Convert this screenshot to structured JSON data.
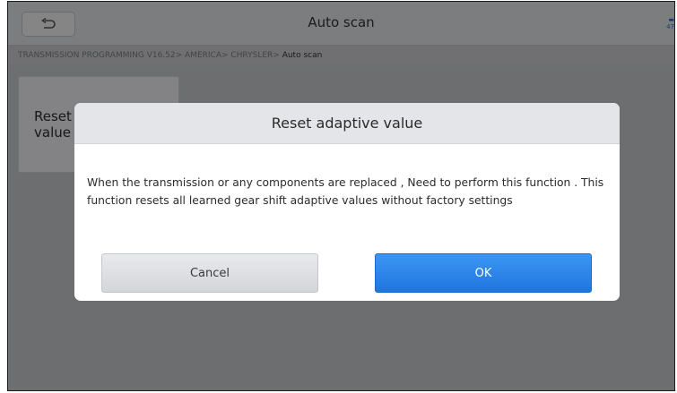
{
  "header": {
    "title": "Auto scan",
    "back_icon": "undo-arrow-icon"
  },
  "breadcrumb": {
    "path": "TRANSMISSION PROGRAMMING V16.52> AMERICA> CHRYSLER>",
    "current": " Auto scan"
  },
  "function_card": {
    "label": "Reset adaptive value"
  },
  "dialog": {
    "title": "Reset adaptive value",
    "message": "When the transmission or any components are replaced , Need to perform this function . This function resets all learned gear shift adaptive values without factory settings",
    "cancel_label": "Cancel",
    "ok_label": "OK"
  },
  "colors": {
    "accent": "#2b82ea",
    "dialog_header": "#e4e5e8"
  }
}
